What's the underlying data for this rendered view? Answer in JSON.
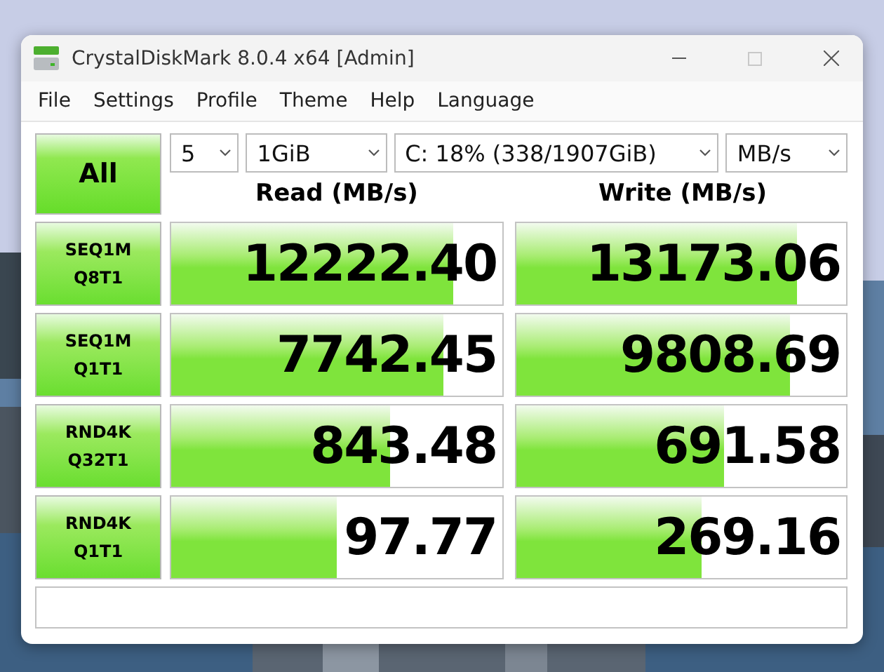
{
  "window": {
    "title": "CrystalDiskMark 8.0.4 x64 [Admin]"
  },
  "menu": [
    "File",
    "Settings",
    "Profile",
    "Theme",
    "Help",
    "Language"
  ],
  "controls": {
    "all_button": "All",
    "count": "5",
    "size": "1GiB",
    "drive": "C: 18% (338/1907GiB)",
    "unit": "MB/s"
  },
  "columns": [
    "Read (MB/s)",
    "Write (MB/s)"
  ],
  "rows": [
    {
      "test": "SEQ1M",
      "params": "Q8T1",
      "read": {
        "value": "12222.40",
        "level": 0.85
      },
      "write": {
        "value": "13173.06",
        "level": 0.85
      }
    },
    {
      "test": "SEQ1M",
      "params": "Q1T1",
      "read": {
        "value": "7742.45",
        "level": 0.82
      },
      "write": {
        "value": "9808.69",
        "level": 0.83
      }
    },
    {
      "test": "RND4K",
      "params": "Q32T1",
      "read": {
        "value": "843.48",
        "level": 0.66
      },
      "write": {
        "value": "691.58",
        "level": 0.63
      }
    },
    {
      "test": "RND4K",
      "params": "Q1T1",
      "read": {
        "value": "97.77",
        "level": 0.5
      },
      "write": {
        "value": "269.16",
        "level": 0.56
      }
    }
  ]
}
